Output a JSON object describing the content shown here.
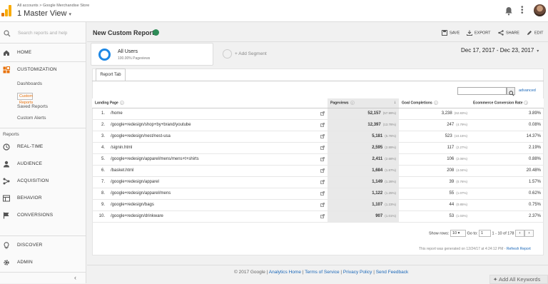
{
  "header": {
    "breadcrumb_accounts": "All accounts",
    "breadcrumb_sep": ">",
    "breadcrumb_property": "Google Merchandise Store",
    "view_title": "1 Master View"
  },
  "sidebar": {
    "search_placeholder": "Search reports and help",
    "home": "HOME",
    "customization": "CUSTOMIZATION",
    "customization_items": [
      "Dashboards",
      "Custom Reports",
      "Saved Reports",
      "Custom Alerts"
    ],
    "reports_section": "Reports",
    "report_items": [
      "REAL-TIME",
      "AUDIENCE",
      "ACQUISITION",
      "BEHAVIOR",
      "CONVERSIONS"
    ],
    "discover": "DISCOVER",
    "admin": "ADMIN"
  },
  "toolbar": {
    "page_title": "New Custom Report",
    "save": "SAVE",
    "export": "EXPORT",
    "share": "SHARE",
    "edit": "EDIT"
  },
  "segment": {
    "name": "All Users",
    "pct": "100.00% Pageviews",
    "add_segment": "+ Add Segment"
  },
  "date_range": "Dec 17, 2017 - Dec 23, 2017",
  "tab_label": "Report Tab",
  "advanced_label": "advanced",
  "table": {
    "columns": [
      "Landing Page",
      "Pageviews",
      "Goal Completions",
      "Ecommerce Conversion Rate"
    ],
    "rows": [
      {
        "idx": "1.",
        "page": "/home",
        "pv": "52,157",
        "pv_pct": "(57.99%)",
        "gc": "3,238",
        "gc_pct": "(62.83%)",
        "ecr": "3.89%"
      },
      {
        "idx": "2.",
        "page": "/google+redesign/shop+by+brand/youtube",
        "pv": "12,397",
        "pv_pct": "(13.78%)",
        "gc": "247",
        "gc_pct": "(4.79%)",
        "ecr": "0.08%"
      },
      {
        "idx": "3.",
        "page": "/google+redesign/nest/nest-usa",
        "pv": "5,181",
        "pv_pct": "(5.76%)",
        "gc": "523",
        "gc_pct": "(10.15%)",
        "ecr": "14.37%"
      },
      {
        "idx": "4.",
        "page": "/signin.html",
        "pv": "2,595",
        "pv_pct": "(2.89%)",
        "gc": "117",
        "gc_pct": "(2.27%)",
        "ecr": "2.19%"
      },
      {
        "idx": "5.",
        "page": "/google+redesign/apparel/mens/mens+t+shirts",
        "pv": "2,411",
        "pv_pct": "(2.68%)",
        "gc": "106",
        "gc_pct": "(2.06%)",
        "ecr": "0.88%"
      },
      {
        "idx": "6.",
        "page": "/basket.html",
        "pv": "1,684",
        "pv_pct": "(1.87%)",
        "gc": "208",
        "gc_pct": "(4.04%)",
        "ecr": "20.48%"
      },
      {
        "idx": "7.",
        "page": "/google+redesign/apparel",
        "pv": "1,149",
        "pv_pct": "(1.28%)",
        "gc": "39",
        "gc_pct": "(0.76%)",
        "ecr": "1.57%"
      },
      {
        "idx": "8.",
        "page": "/google+redesign/apparel/mens",
        "pv": "1,122",
        "pv_pct": "(1.25%)",
        "gc": "55",
        "gc_pct": "(1.07%)",
        "ecr": "0.62%"
      },
      {
        "idx": "9.",
        "page": "/google+redesign/bags",
        "pv": "1,107",
        "pv_pct": "(1.23%)",
        "gc": "44",
        "gc_pct": "(0.85%)",
        "ecr": "0.75%"
      },
      {
        "idx": "10.",
        "page": "/google+redesign/drinkware",
        "pv": "907",
        "pv_pct": "(1.01%)",
        "gc": "53",
        "gc_pct": "(1.03%)",
        "ecr": "2.37%"
      }
    ]
  },
  "pager": {
    "show_rows_label": "Show rows:",
    "rows_value": "10",
    "goto_label": "Go to:",
    "goto_value": "1",
    "range": "1 - 10 of 178",
    "prev": "‹",
    "next": "›"
  },
  "generated": {
    "text": "This report was generated on 12/24/17 at 4:24:12 PM -",
    "refresh": "Refresh Report"
  },
  "footer": {
    "copyright": "© 2017 Google",
    "links": [
      "Analytics Home",
      "Terms of Service",
      "Privacy Policy",
      "Send Feedback"
    ],
    "separator": "|",
    "add_keywords": "Add All Keywords"
  },
  "colors": {
    "accent_blue": "#1e88e5",
    "active_orange": "#e8710a",
    "link_blue": "#1a67b8",
    "success_green": "#2e8b57"
  }
}
